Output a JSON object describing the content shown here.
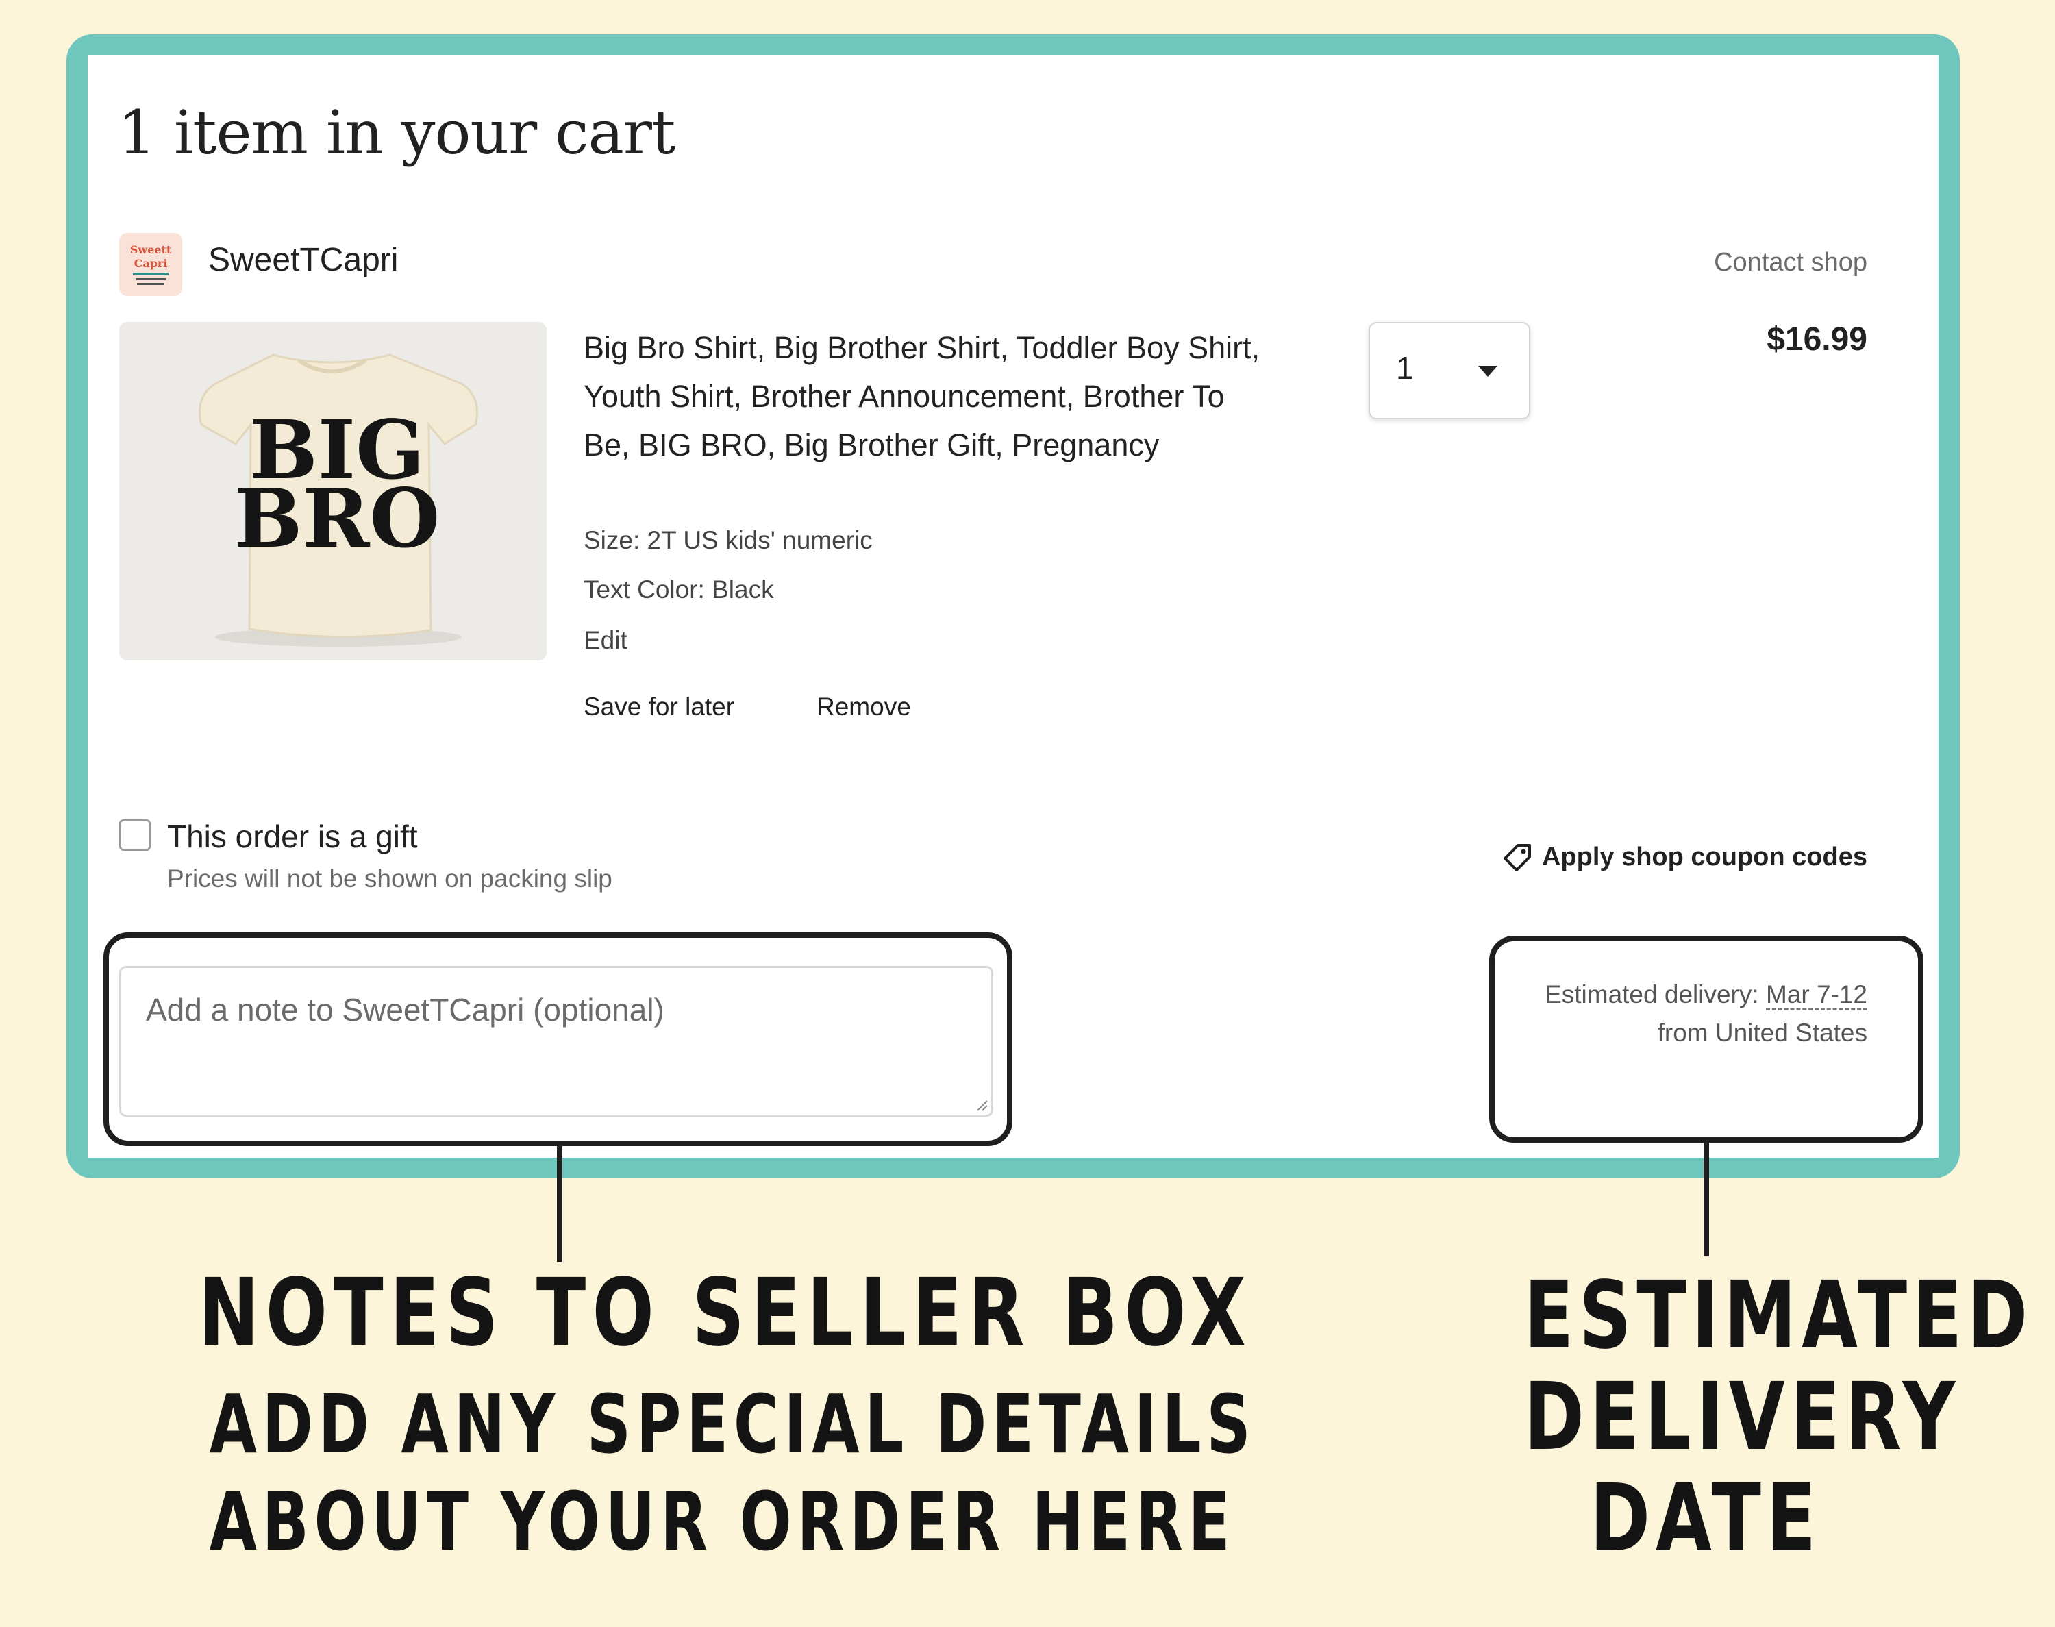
{
  "cart": {
    "title": "1 item in your cart",
    "shop": {
      "name": "SweetTCapri",
      "logo_text": "Sweett Capri",
      "contact_label": "Contact shop"
    },
    "item": {
      "image_text_line1": "BIG",
      "image_text_line2": "BRO",
      "title": "Big Bro Shirt, Big Brother Shirt, Toddler Boy Shirt, Youth Shirt, Brother Announcement, Brother To Be, BIG BRO, Big Brother Gift, Pregnancy",
      "size": "Size: 2T US kids' numeric",
      "text_color": "Text Color: Black",
      "edit_label": "Edit",
      "save_for_later_label": "Save for later",
      "remove_label": "Remove",
      "quantity": "1",
      "price": "$16.99"
    },
    "gift": {
      "label": "This order is a gift",
      "hint": "Prices will not be shown on packing slip",
      "checked": false
    },
    "coupon": {
      "label": "Apply shop coupon codes",
      "icon": "tag-icon"
    },
    "note": {
      "placeholder": "Add a note to SweetTCapri (optional)"
    },
    "delivery": {
      "prefix": "Estimated delivery: ",
      "date": "Mar 7-12",
      "origin": "from United States"
    }
  },
  "annotations": {
    "notes_heading": "NOTES TO SELLER BOX",
    "notes_line1": "ADD ANY SPECIAL DETAILS",
    "notes_line2": "ABOUT YOUR ORDER HERE",
    "delivery_line1": "ESTIMATED",
    "delivery_line2": "DELIVERY",
    "delivery_line3": "DATE"
  },
  "colors": {
    "page_background": "#fdf5d9",
    "frame": "#6fc6bd",
    "panel": "#ffffff",
    "annotation_ink": "#141414"
  }
}
